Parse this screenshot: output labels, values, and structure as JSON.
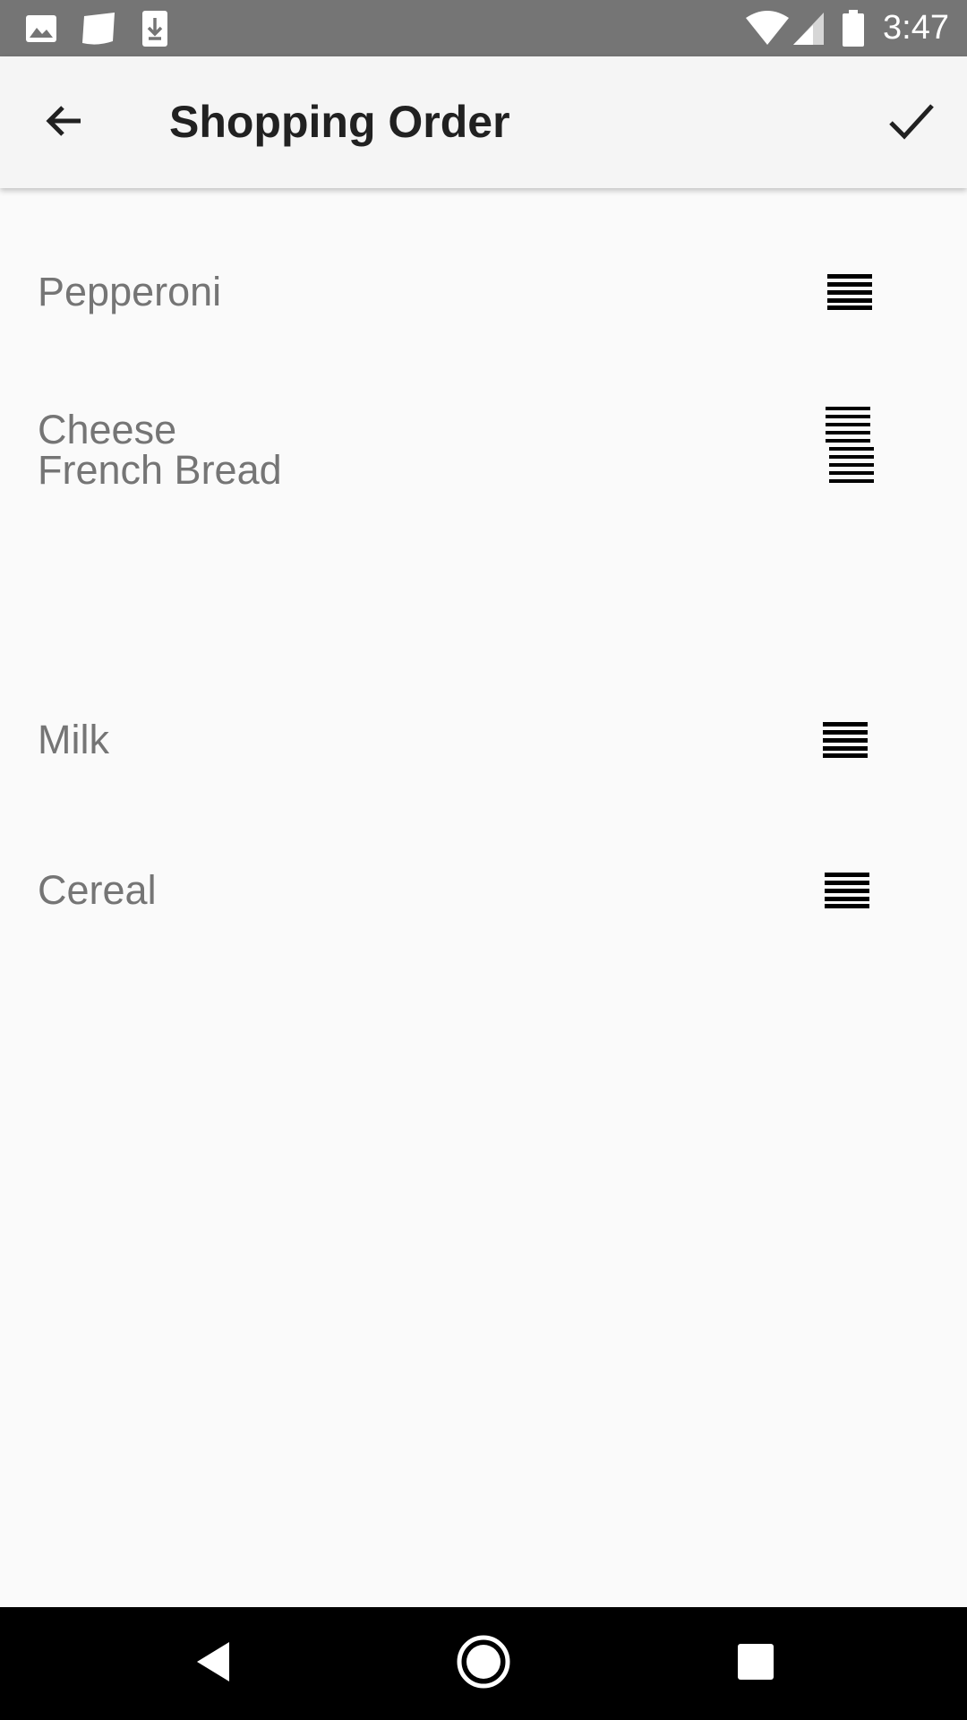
{
  "status_bar": {
    "time": "3:47",
    "icons": [
      "image-icon",
      "note-icon",
      "download-icon",
      "wifi-icon",
      "signal-icon",
      "battery-icon"
    ]
  },
  "app_bar": {
    "title": "Shopping Order",
    "back_icon": "arrow-back-icon",
    "confirm_icon": "check-icon"
  },
  "items": [
    {
      "label": "Pepperoni",
      "handle_icon": "drag-handle-icon"
    },
    {
      "label": "Cheese",
      "handle_icon": "drag-handle-icon"
    },
    {
      "label": "French Bread",
      "handle_icon": "drag-handle-icon"
    },
    {
      "label": "Milk",
      "handle_icon": "drag-handle-icon"
    },
    {
      "label": "Cereal",
      "handle_icon": "drag-handle-icon"
    }
  ],
  "nav_bar": {
    "icons": [
      "nav-back-icon",
      "nav-home-icon",
      "nav-recents-icon"
    ]
  },
  "colors": {
    "status_bar": "#757575",
    "app_bar": "#f5f5f5",
    "background": "#fafafa",
    "item_text": "#757575",
    "nav_bar": "#000000"
  }
}
